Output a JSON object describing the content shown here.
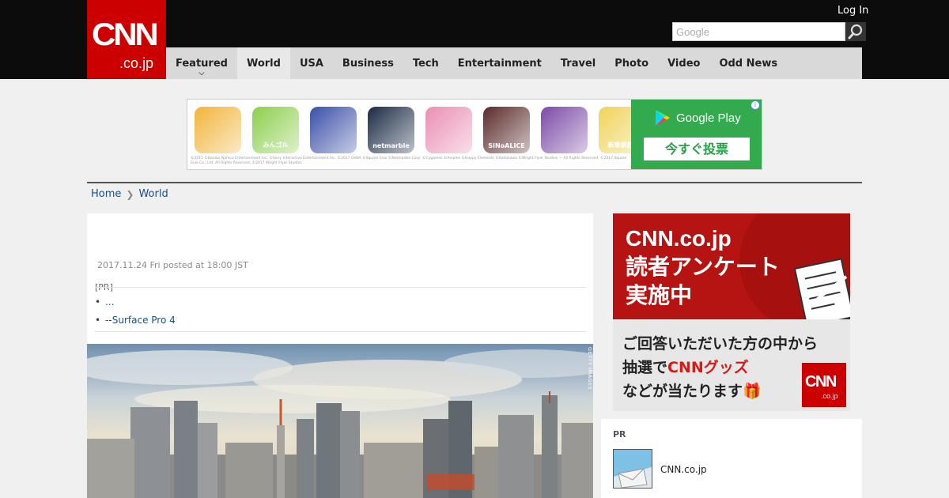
{
  "header": {
    "logo_text": "CNN",
    "logo_sub": ".co.jp",
    "login_label": "Log In",
    "search_placeholder": "Google"
  },
  "nav": {
    "items": [
      "Featured",
      "World",
      "USA",
      "Business",
      "Tech",
      "Entertainment",
      "Travel",
      "Photo",
      "Video",
      "Odd News"
    ],
    "active": "World"
  },
  "ad": {
    "icons": [
      {
        "name": "game-icon-1",
        "color": "#f2b43a",
        "text": ""
      },
      {
        "name": "game-icon-2",
        "color": "#8ccf4d",
        "text": "みんゴル"
      },
      {
        "name": "game-icon-3",
        "color": "#3a4fa8",
        "text": ""
      },
      {
        "name": "game-icon-4",
        "color": "#1a2a44",
        "text": "netmarble"
      },
      {
        "name": "game-icon-5",
        "color": "#e98fb4",
        "text": ""
      },
      {
        "name": "game-icon-6",
        "color": "#5a2a2a",
        "text": "SINoALICE"
      },
      {
        "name": "game-icon-7",
        "color": "#7b4aa6",
        "text": ""
      },
      {
        "name": "game-icon-8",
        "color": "#f0d35a",
        "text": "新章解放!"
      }
    ],
    "store_label": "Google Play",
    "button_label": "今すぐ投票",
    "info_icon": "i",
    "fine_print": "©2015 ©Bandai Namco Entertainment Inc. ©Sony Interactive Entertainment Inc. ©2017 DeNA ©Square Enix ©Netmarble Corp. ©Cygames ©Aniplex ©Happy Elements ©Kadokawa ©Wright Flyer Studios — All Rights Reserved. ©2017 Square Enix Co., Ltd. All Rights Reserved. ©2017 Wright Flyer Studios"
  },
  "breadcrumb": {
    "home": "Home",
    "current": "World"
  },
  "article": {
    "date": "2017.11.24 Fri posted at 18:00 JST",
    "pr_tag": "[PR]",
    "pr_links": [
      "...",
      "--Surface Pro 4"
    ],
    "photo_credit": "GETTY IMAGES"
  },
  "sidebar": {
    "survey_title_lines": [
      "CNN.co.jp",
      "読者アンケート",
      "実施中"
    ],
    "survey_lines": [
      "ご回答いただいた方の中から",
      "抽選で",
      "CNNグッズ",
      "などが当たります"
    ],
    "survey_logo": "CNN",
    "survey_logo_sub": ".co.jp",
    "pr_label": "PR",
    "pr_site": "CNN.co.jp"
  },
  "colors": {
    "brand_red": "#cc0000",
    "topbar": "#0c0c0c",
    "nav_bg": "#d9d9d9",
    "link": "#1a4f86",
    "play_green": "#33aa4e"
  }
}
